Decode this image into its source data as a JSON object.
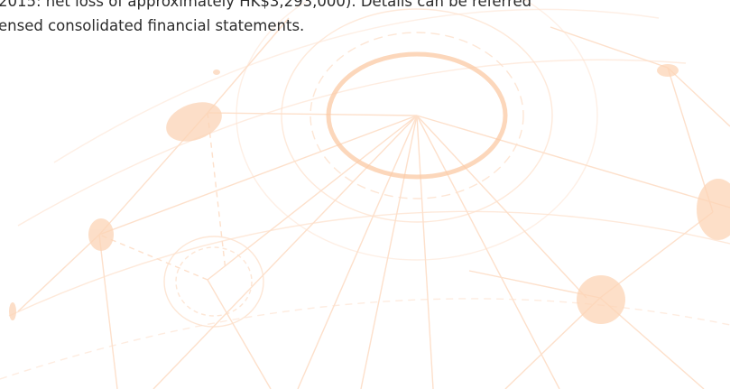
{
  "text": {
    "line1": "2015: net loss of approximately HK$3,293,000). Details can be referred",
    "line2": "ensed consolidated financial statements."
  },
  "colors": {
    "text": "#2b2b2b",
    "network_line": "#fcd9bf",
    "network_node": "#fbd6bb"
  },
  "graphic": {
    "icon": "globe-network-watermark"
  }
}
